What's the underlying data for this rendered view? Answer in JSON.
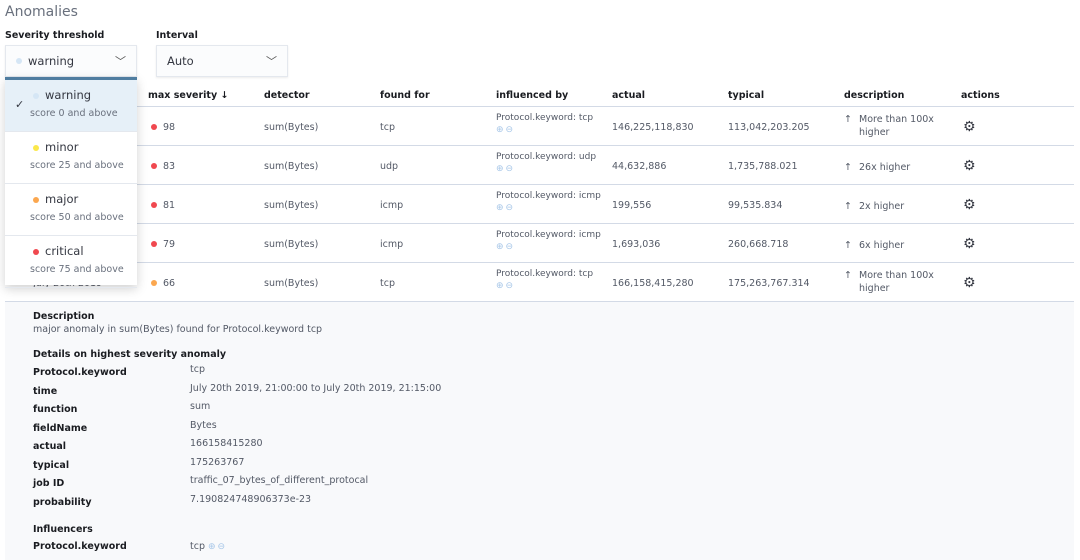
{
  "title": "Anomalies",
  "severity": {
    "label": "Severity threshold",
    "value": "warning",
    "dot_color": "#d5e6f5",
    "options": [
      {
        "label": "warning",
        "sub": "score 0 and above",
        "color": "#d5e6f5",
        "selected": true
      },
      {
        "label": "minor",
        "sub": "score 25 and above",
        "color": "#fbe84a"
      },
      {
        "label": "major",
        "sub": "score 50 and above",
        "color": "#fba74f"
      },
      {
        "label": "critical",
        "sub": "score 75 and above",
        "color": "#f0484f"
      }
    ]
  },
  "interval": {
    "label": "Interval",
    "value": "Auto"
  },
  "table": {
    "headers": {
      "severity": "max severity ↓",
      "detector": "detector",
      "found_for": "found for",
      "influenced_by": "influenced by",
      "actual": "actual",
      "typical": "typical",
      "description": "description",
      "actions": "actions"
    },
    "rows": [
      {
        "time": "",
        "severity": "98",
        "color": "#f0484f",
        "detector": "sum(Bytes)",
        "found_for": "tcp",
        "influenced_by": "Protocol.keyword: tcp",
        "actual": "146,225,118,830",
        "typical": "113,042,203.205",
        "description": "More than 100x higher"
      },
      {
        "time": "",
        "severity": "83",
        "color": "#f0484f",
        "detector": "sum(Bytes)",
        "found_for": "udp",
        "influenced_by": "Protocol.keyword: udp",
        "actual": "44,632,886",
        "typical": "1,735,788.021",
        "description": "26x higher"
      },
      {
        "time": "",
        "severity": "81",
        "color": "#f0484f",
        "detector": "sum(Bytes)",
        "found_for": "icmp",
        "influenced_by": "Protocol.keyword: icmp",
        "actual": "199,556",
        "typical": "99,535.834",
        "description": "2x higher"
      },
      {
        "time": "",
        "severity": "79",
        "color": "#f0484f",
        "detector": "sum(Bytes)",
        "found_for": "icmp",
        "influenced_by": "Protocol.keyword: icmp",
        "actual": "1,693,036",
        "typical": "260,668.718",
        "description": "6x higher"
      },
      {
        "time": "July 20th 2019",
        "severity": "66",
        "color": "#fba74f",
        "detector": "sum(Bytes)",
        "found_for": "tcp",
        "influenced_by": "Protocol.keyword: tcp",
        "actual": "166,158,415,280",
        "typical": "175,263,767.314",
        "description": "More than 100x higher"
      }
    ]
  },
  "details": {
    "description_label": "Description",
    "description": "major anomaly in sum(Bytes) found for Protocol.keyword tcp",
    "highest_label": "Details on highest severity anomaly",
    "fields": [
      {
        "k": "Protocol.keyword",
        "v": "tcp"
      },
      {
        "k": "time",
        "v": "July 20th 2019, 21:00:00 to July 20th 2019, 21:15:00"
      },
      {
        "k": "function",
        "v": "sum"
      },
      {
        "k": "fieldName",
        "v": "Bytes"
      },
      {
        "k": "actual",
        "v": "166158415280"
      },
      {
        "k": "typical",
        "v": "175263767"
      },
      {
        "k": "job ID",
        "v": "traffic_07_bytes_of_different_protocal"
      },
      {
        "k": "probability",
        "v": "7.190824748906373e-23"
      }
    ],
    "influencers_label": "Influencers",
    "influencer": {
      "k": "Protocol.keyword",
      "v": "tcp"
    }
  }
}
